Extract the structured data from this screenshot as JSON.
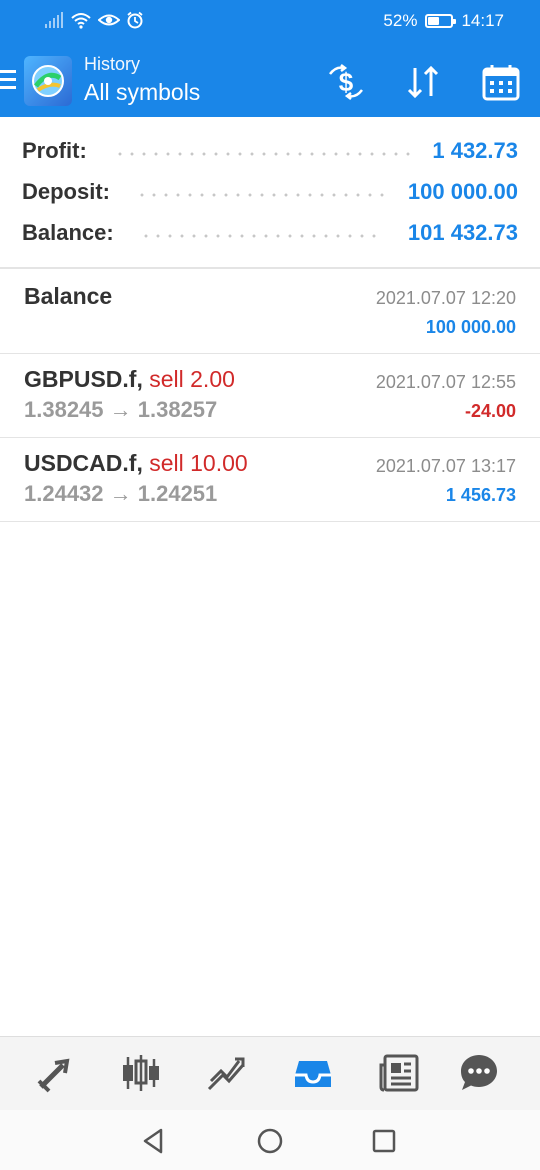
{
  "status_bar": {
    "battery_text": "52%",
    "battery_level": 0.52,
    "time": "14:17",
    "icons": [
      "signal-icon",
      "wifi-icon",
      "eye-icon",
      "alarm-icon",
      "battery-icon"
    ]
  },
  "app_bar": {
    "subtitle": "History",
    "title": "All symbols",
    "icons": [
      "menu-icon",
      "app-logo",
      "deals-icon",
      "sort-icon",
      "calendar-icon"
    ]
  },
  "summary": {
    "profit_label": "Profit:",
    "profit_value": "1 432.73",
    "deposit_label": "Deposit:",
    "deposit_value": "100 000.00",
    "balance_label": "Balance:",
    "balance_value": "101 432.73"
  },
  "entries": [
    {
      "title": "Balance",
      "date": "2021.07.07 12:20",
      "amount": "100 000.00"
    },
    {
      "symbol": "GBPUSD.f,",
      "action": "sell 2.00",
      "prices": "1.38245 → 1.38257",
      "date": "2021.07.07 12:55",
      "amount": "-24.00"
    },
    {
      "symbol": "USDCAD.f,",
      "action": "sell 10.00",
      "prices": "1.24432 → 1.24251",
      "date": "2021.07.07 13:17",
      "amount": "1 456.73"
    }
  ],
  "bottom_nav": {
    "items": [
      "quotes-icon",
      "charts-icon",
      "trade-icon",
      "history-icon",
      "news-icon",
      "chat-icon"
    ],
    "active": "history-icon"
  },
  "colors": {
    "accent": "#1a86e8",
    "negative": "#d12a2a",
    "muted": "#9a9a9a",
    "nav_active": "#1a86e8",
    "nav_inactive": "#555555"
  }
}
